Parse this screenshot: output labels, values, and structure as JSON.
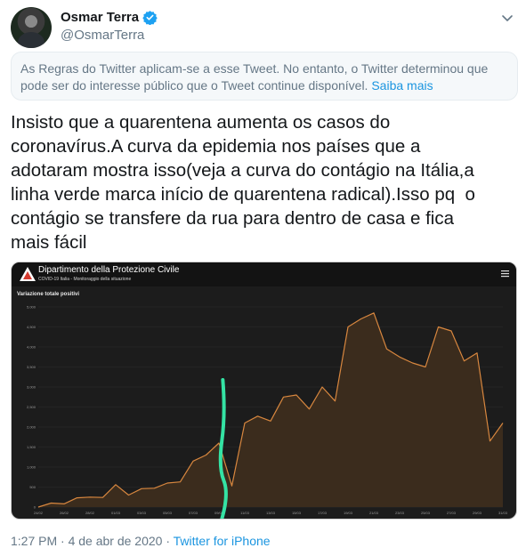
{
  "author": {
    "display_name": "Osmar Terra",
    "handle": "@OsmarTerra",
    "verified_icon": "verified-badge-icon",
    "verified_color": "#1da1f2"
  },
  "notice": {
    "text": "As Regras do Twitter aplicam-se a esse Tweet. No entanto, o Twitter determinou que pode ser do interesse público que o Tweet continue disponível.",
    "link": "Saiba mais"
  },
  "tweet": {
    "lines": [
      "Insisto que a quarentena aumenta os casos do",
      "coronavírus.A curva da epidemia nos países que a",
      "adotaram mostra isso(veja a curva do contágio na Itália,a",
      "linha verde marca início de quarentena radical).Isso pq  o",
      "contágio se transfere da rua para dentro de casa e fica",
      "mais fácil"
    ]
  },
  "media": {
    "header_title": "Dipartimento della Protezione Civile",
    "header_subtitle": "COVID-19 Italia - Monitoraggio della situazione",
    "chart_data": {
      "type": "area",
      "title": "Variazione totale positivi",
      "y_ticks": [
        "0",
        "500",
        "1,000",
        "1,500",
        "2,000",
        "2,500",
        "3,000",
        "3,500",
        "4,000",
        "4,500",
        "5,000"
      ],
      "ylim": [
        0,
        5000
      ],
      "x_tick_labels": [
        "24/02",
        "26/02",
        "28/02",
        "01/03",
        "03/03",
        "05/03",
        "07/03",
        "09/03",
        "11/03",
        "13/03",
        "15/03",
        "17/03",
        "19/03",
        "21/03",
        "23/03",
        "25/03",
        "27/03",
        "29/03",
        "31/03"
      ],
      "categories": [
        "24/02",
        "25/02",
        "26/02",
        "27/02",
        "28/02",
        "29/02",
        "01/03",
        "02/03",
        "03/03",
        "04/03",
        "05/03",
        "06/03",
        "07/03",
        "08/03",
        "09/03",
        "10/03",
        "11/03",
        "12/03",
        "13/03",
        "14/03",
        "15/03",
        "16/03",
        "17/03",
        "18/03",
        "19/03",
        "20/03",
        "21/03",
        "22/03",
        "23/03",
        "24/03",
        "25/03",
        "26/03",
        "27/03",
        "28/03",
        "29/03",
        "30/03",
        "31/03"
      ],
      "values": [
        0,
        100,
        80,
        230,
        250,
        240,
        560,
        300,
        460,
        470,
        600,
        630,
        1150,
        1300,
        1600,
        530,
        2100,
        2270,
        2150,
        2750,
        2800,
        2450,
        3000,
        2650,
        4500,
        4700,
        4850,
        3950,
        3750,
        3600,
        3500,
        4500,
        4400,
        3650,
        3850,
        1650,
        2100
      ],
      "series_color": "#d8873f",
      "fill_color": "#3d2d1e",
      "grid": true,
      "marker_line_color": "#34e3a4",
      "marker_after_category": "09/03"
    }
  },
  "footer": {
    "time": "1:27 PM · 4 de abr de 2020 · ",
    "source": "Twitter for iPhone"
  }
}
